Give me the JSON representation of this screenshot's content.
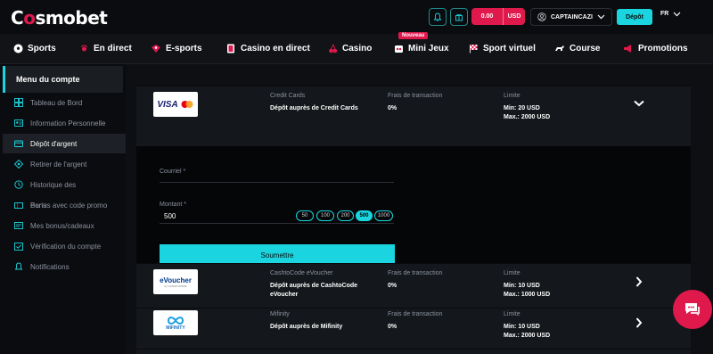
{
  "header": {
    "logo_pre": "C",
    "logo_o": "o",
    "logo_post": "smobet",
    "balance_amount": "0.00",
    "balance_currency": "USD",
    "username": "CAPTAINCAZI",
    "deposit_label": "Dépôt",
    "language": "FR",
    "colors": {
      "accent": "#1ad5e0",
      "brand": "#e0194d"
    }
  },
  "nav": {
    "badge": "Nouveau",
    "items": [
      {
        "label": "Sports",
        "icon": "soccer-ball-icon"
      },
      {
        "label": "En direct",
        "icon": "live-icon"
      },
      {
        "label": "E-sports",
        "icon": "gamepad-icon"
      },
      {
        "label": "Casino en direct",
        "icon": "card-icon"
      },
      {
        "label": "Casino",
        "icon": "cherry-icon"
      },
      {
        "label": "Mini Jeux",
        "icon": "mini-games-icon"
      },
      {
        "label": "Sport virtuel",
        "icon": "racing-flag-icon"
      },
      {
        "label": "Course",
        "icon": "horse-icon"
      },
      {
        "label": "Promotions",
        "icon": "megaphone-icon"
      }
    ]
  },
  "sidebar": {
    "title": "Menu du compte",
    "items": [
      {
        "label": "Tableau de Bord",
        "icon": "dashboard-icon"
      },
      {
        "label": "Information Personnelle",
        "icon": "id-card-icon"
      },
      {
        "label": "Dépôt d'argent",
        "icon": "wallet-icon"
      },
      {
        "label": "Retirer de l'argent",
        "icon": "withdraw-icon"
      },
      {
        "label": "Historique des",
        "icon": "history-icon"
      },
      {
        "label": "Bonus avec code promo",
        "icon": "promo-code-icon",
        "overlay_text": "Paris"
      },
      {
        "label": "Mes bonus/cadeaux",
        "icon": "gift-icon"
      },
      {
        "label": "Vérification du compte",
        "icon": "verify-icon"
      },
      {
        "label": "Notifications",
        "icon": "bell-icon"
      }
    ]
  },
  "methods": [
    {
      "logo": "VISA",
      "name": "Credit Cards",
      "desc": "Dépôt auprès de Credit Cards",
      "fee_label": "Frais de transaction",
      "fee": "0%",
      "limit_label": "Limite",
      "min": "Min: 20 USD",
      "max": "Max.: 2000 USD"
    },
    {
      "logo": "eVoucher",
      "logo_sub": "by CASHTOCODE",
      "name": "CashtoCode eVoucher",
      "desc": "Dépôt auprès de CashtoCode eVoucher",
      "fee_label": "Frais de transaction",
      "fee": "0%",
      "limit_label": "Limite",
      "min": "Min: 10 USD",
      "max": "Max.: 1000 USD"
    },
    {
      "logo": "MIFINITY",
      "name": "Mifinity",
      "desc": "Dépôt auprès de Mifinity",
      "fee_label": "Frais de transaction",
      "fee": "0%",
      "limit_label": "Limite",
      "min": "Min: 10 USD",
      "max": "Max.: 2000 USD"
    }
  ],
  "form": {
    "email_label": "Courriel *",
    "email_value": "",
    "amount_label": "Montant *",
    "amount_value": "500",
    "chips": [
      "50",
      "100",
      "200",
      "500",
      "1000"
    ],
    "selected_chip": "500",
    "submit_label": "Soumettre"
  }
}
